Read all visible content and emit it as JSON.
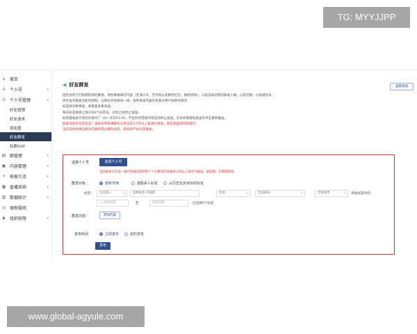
{
  "watermarks": {
    "top": "TG: MYYJJPP",
    "bottom": "www.global-agyule.com"
  },
  "sidebar": {
    "items": [
      {
        "icon": "⌂",
        "label": "首页",
        "arrow": ""
      },
      {
        "icon": "♙",
        "label": "个人号",
        "arrow": "▾"
      },
      {
        "icon": "♙",
        "label": "个人号管理",
        "arrow": "▾"
      }
    ],
    "subitems": [
      {
        "label": "好友管理",
        "active": false
      },
      {
        "label": "好友请求",
        "active": false
      },
      {
        "label": "朋友圈",
        "active": false
      },
      {
        "label": "好友群发",
        "active": true
      },
      {
        "label": "私聊SOP",
        "active": false
      }
    ],
    "groups": [
      {
        "icon": "▤",
        "label": "群管理",
        "arrow": "▾"
      },
      {
        "icon": "▣",
        "label": "内容管理",
        "arrow": "▾"
      },
      {
        "icon": "⌖",
        "label": "拓客引流",
        "arrow": "▾"
      },
      {
        "icon": "▦",
        "label": "直播系统",
        "arrow": "▾"
      },
      {
        "icon": "▥",
        "label": "数据统计",
        "arrow": "▾"
      },
      {
        "icon": "◎",
        "label": "保粉服务",
        "arrow": ""
      },
      {
        "icon": "♟",
        "label": "组织权限",
        "arrow": "▾"
      }
    ]
  },
  "page": {
    "title": "好友群发",
    "help_button": "查看帮助",
    "intro_lines": [
      {
        "text": "固然没有万打粉销售得的警惕，请务要确填写内容（无海口令，无外链以及精悉红包，群校修导），以及选择适量的群发人数，以及次数，以防被封号。",
        "red": false
      },
      {
        "text": "另外由于群发功能的限制，与微信手动群发一样，会有发送内容仅有部分用户收到的情况",
        "red": false
      },
      {
        "text": "如选择对象重复，将重复多重发送。",
        "red": false
      },
      {
        "text": "每日好友群发上限2000个好友号，达到上限停止发送。",
        "red": false
      },
      {
        "text": "好友群发执行时间为每日7：00~次日01:00，不在时间范围内将自动停止发送，次日如需继续发送可点击重新推送。",
        "red": false
      },
      {
        "text": "群发消息的对话会显，该账号所发事群时长建议在5小时以上再进行群发，朋友圈里请勿批操作。",
        "red": true
      },
      {
        "text": "当前任务如果已被对方删除或过期的好友，系统将不会对其群发。",
        "red": true
      }
    ]
  },
  "form": {
    "account_label": "选择个人号",
    "account_button": "选择个人号",
    "account_note": "当前群发号包含一意识到通话是到新个人号看到的会面并以到以上再进行群发，朋友圈，幸需暂知道。",
    "target_label": "群发对象：",
    "target_options": [
      {
        "label": "按条件筛",
        "on": true
      },
      {
        "label": "按联系人好友",
        "on": false
      },
      {
        "label": "从历史任务目标的好友",
        "on": false
      }
    ],
    "tags_label": "标签：",
    "tags_select": "包含其一",
    "tags_placeholder": "选择标签 可搜索",
    "filter_selects": [
      "全部",
      "全部省份",
      "全部城市"
    ],
    "add_time_label": "添加好友时间：",
    "date_range": {
      "start": "开始日期",
      "sep": "至",
      "end": "结束日期"
    },
    "selected_count": "已选择0个好友",
    "content_label": "群发内容：",
    "content_button": "添加内容",
    "time_label": "发布时间",
    "time_options": [
      {
        "label": "立即发布",
        "on": true
      },
      {
        "label": "定时发布",
        "on": false
      }
    ],
    "submit": "发布"
  },
  "colors": {
    "primary": "#2f4f8f",
    "active_nav": "#2b3a55",
    "warning_red": "#e0393e",
    "highlight_border": "#c8333b"
  }
}
